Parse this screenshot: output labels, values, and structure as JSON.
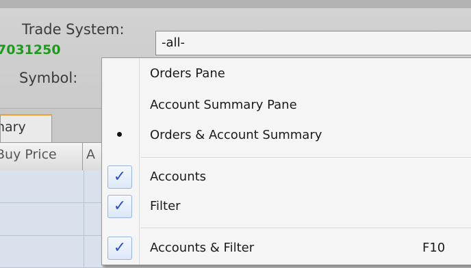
{
  "filter": {
    "trade_system_label": "Trade System:",
    "trade_system_value": "-all-",
    "symbol_label": "Symbol:"
  },
  "tabs": [
    {
      "label": "nary"
    }
  ],
  "grid": {
    "columns": [
      "Buy Price",
      "A"
    ],
    "rows": [
      {
        "buy_price": ""
      },
      {
        "buy_price": "7031250"
      },
      {
        "buy_price": ""
      }
    ],
    "price_color": "#1f9a1f"
  },
  "context_menu": {
    "items": [
      {
        "label": "Orders Pane",
        "marker": "none"
      },
      {
        "label": "Account Summary Pane",
        "marker": "none"
      },
      {
        "label": "Orders & Account Summary",
        "marker": "bullet"
      },
      {
        "label": "Accounts",
        "marker": "check",
        "check_glyph": "✓"
      },
      {
        "label": "Filter",
        "marker": "check",
        "check_glyph": "✓"
      },
      {
        "label": "Accounts & Filter",
        "marker": "check",
        "check_glyph": "✓",
        "shortcut": "F10"
      }
    ],
    "check_color": "#2a52c8"
  }
}
